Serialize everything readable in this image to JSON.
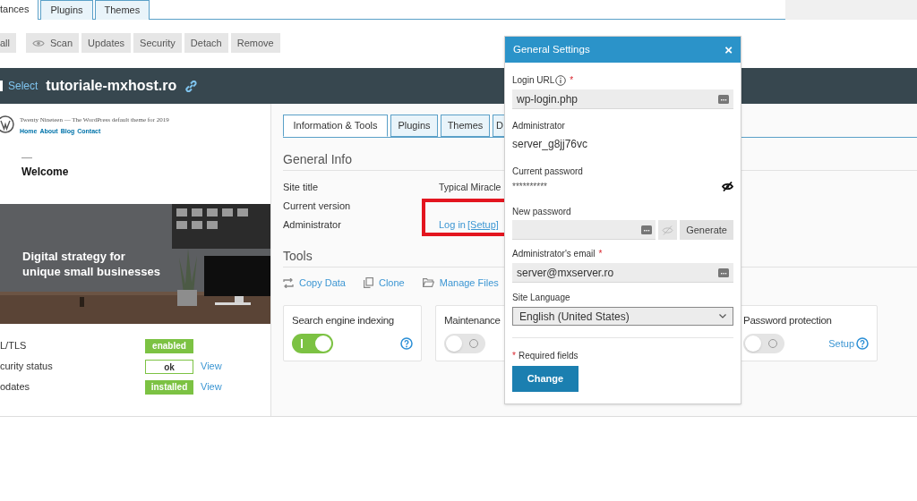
{
  "top_tabs": [
    {
      "label": "tances",
      "selected": true
    },
    {
      "label": "Plugins",
      "selected": false
    },
    {
      "label": "Themes",
      "selected": false
    }
  ],
  "toolbar": [
    {
      "label": "all",
      "icon": false
    },
    {
      "label": "Scan",
      "icon": true
    },
    {
      "label": "Updates",
      "icon": false
    },
    {
      "label": "Security",
      "icon": false
    },
    {
      "label": "Detach",
      "icon": false
    },
    {
      "label": "Remove",
      "icon": false
    }
  ],
  "site_header": {
    "checked": false,
    "select_label": "Select",
    "site_name": "tutoriale-mxhost.ro"
  },
  "preview": {
    "theme_line": "Twenty Nineteen — The WordPress default theme for 2019",
    "nav": [
      "Home",
      "About",
      "Blog",
      "Contact"
    ],
    "heading": "Welcome",
    "headline": "Digital strategy for unique small businesses"
  },
  "statuses": [
    {
      "label": "L/TLS",
      "badge": "enabled",
      "kind": "filled"
    },
    {
      "label": "curity status",
      "badge": "ok",
      "kind": "outline",
      "link": "View"
    },
    {
      "label": "odates",
      "badge": "installed",
      "kind": "filled",
      "link": "View"
    }
  ],
  "detail_tabs": [
    {
      "label": "Information & Tools",
      "selected": true
    },
    {
      "label": "Plugins",
      "selected": false
    },
    {
      "label": "Themes",
      "selected": false
    },
    {
      "label": "D",
      "selected": false
    }
  ],
  "general_info": {
    "title": "General Info",
    "rows": [
      {
        "label": "Site title",
        "value": "Typical Miracle"
      },
      {
        "label": "Current version"
      },
      {
        "label": "Administrator",
        "login_link": "Log in",
        "setup_link": "[Setup]",
        "highlighted": true
      }
    ]
  },
  "tools": {
    "title": "Tools",
    "links": [
      {
        "label": "Copy Data",
        "kind": "copy"
      },
      {
        "label": "Clone",
        "kind": "clone"
      },
      {
        "label": "Manage Files",
        "kind": "files"
      }
    ],
    "cards": [
      {
        "title": "Search engine indexing",
        "on": true,
        "help": true
      },
      {
        "title": "Maintenance",
        "on": false
      },
      {
        "title": "Password protection",
        "on": false,
        "help": true,
        "link": "Setup"
      }
    ]
  },
  "dialog": {
    "title": "General Settings",
    "close": "×",
    "login_url": {
      "label": "Login URL",
      "required_mark": "*",
      "value": "wp-login.php"
    },
    "administrator": {
      "label": "Administrator",
      "value": "server_g8jj76vc"
    },
    "current_password": {
      "label": "Current password",
      "value": "**********"
    },
    "new_password": {
      "label": "New password",
      "generate": "Generate"
    },
    "email": {
      "label": "Administrator's email",
      "required_mark": "*",
      "value": "server@mxserver.ro"
    },
    "language": {
      "label": "Site Language",
      "value": "English (United States)"
    },
    "note_mark": "*",
    "note": "Required fields",
    "submit": "Change"
  }
}
